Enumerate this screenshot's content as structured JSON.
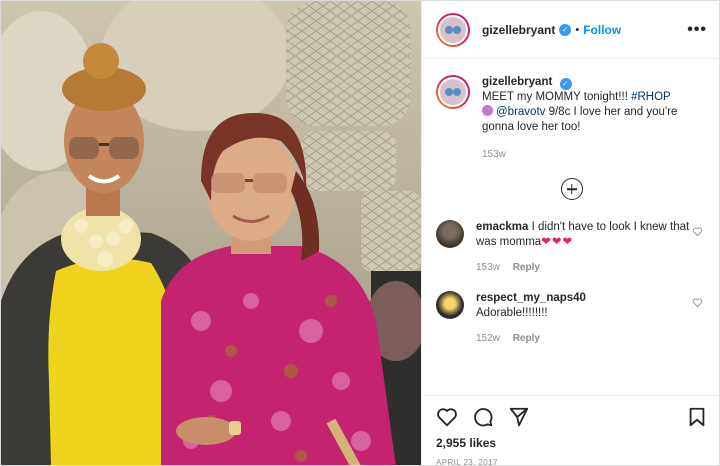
{
  "post": {
    "username": "gizellebryant",
    "dot": "•",
    "follow_label": "Follow",
    "more_label": "•••"
  },
  "caption": {
    "username": "gizellebryant",
    "text_before": "MEET my MOMMY tonight!!! ",
    "hashtag": "#RHOP",
    "mention": "@bravotv",
    "text_after": " 9/8c I love her and you're gonna love her too!",
    "time": "153w"
  },
  "comments": [
    {
      "username": "emackma",
      "text": "I didn't have to look I knew that was momma",
      "hearts": "❤❤❤",
      "time": "153w",
      "reply": "Reply"
    },
    {
      "username": "respect_my_naps40",
      "text": "Adorable!!!!!!!!",
      "time": "152w",
      "reply": "Reply"
    }
  ],
  "actions": {
    "likes": "2,955 likes",
    "date": "APRIL 23, 2017"
  },
  "icons": [
    "verified-badge-icon",
    "more-options-icon",
    "load-more-icon",
    "heart-icon",
    "comment-icon",
    "share-icon",
    "bookmark-icon"
  ]
}
